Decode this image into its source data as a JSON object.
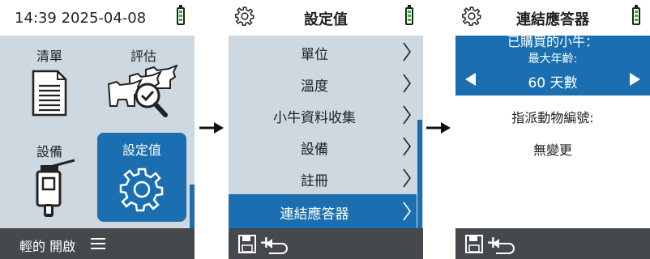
{
  "screen1": {
    "status_time": "14:39 2025-04-08",
    "tiles": [
      {
        "label": "清單",
        "icon": "document-list-icon"
      },
      {
        "label": "評估",
        "icon": "cattle-magnifier-icon"
      },
      {
        "label": "設備",
        "icon": "handheld-device-icon"
      },
      {
        "label": "設定值",
        "icon": "gear-icon"
      }
    ],
    "footer_label": "輕的 開啟",
    "footer_menu_icon": "hamburger-menu-icon"
  },
  "screen2": {
    "title": "設定值",
    "items": [
      "單位",
      "溫度",
      "小牛資料收集",
      "設備",
      "註冊",
      "連結應答器"
    ],
    "selected_index": 5
  },
  "screen3": {
    "title": "連結應答器",
    "banner_line1": "已購買的小牛：",
    "banner_line2": "最大年齡:",
    "value": "60 天數",
    "field_label": "指派動物編號:",
    "field_value": "無變更"
  },
  "footer_actions": {
    "plus": "+"
  },
  "colors": {
    "accent": "#1b6fb0",
    "panel": "#cdd8e1",
    "footer": "#45484d",
    "battery": "#2dbb2d"
  }
}
